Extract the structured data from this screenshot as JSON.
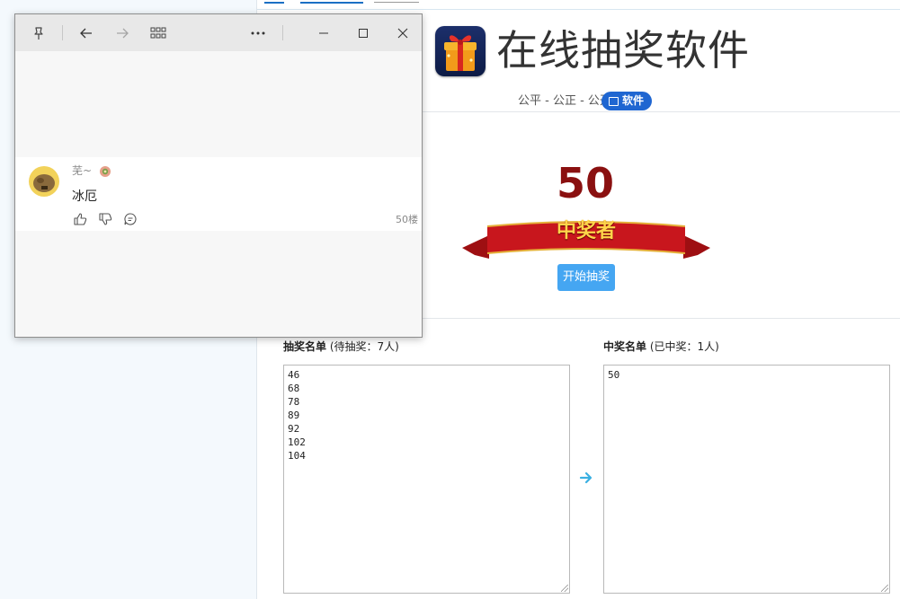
{
  "page": {
    "title": "在线抽奖软件",
    "subtitle": "公平 - 公正 - 公开",
    "badge": "软件",
    "winner_display": "50",
    "ribbon_label": "中奖者",
    "start_button": "开始抽奖",
    "pool_list": {
      "title": "抽奖名单",
      "count_text": "(待抽奖：7人)",
      "entries": [
        "46",
        "68",
        "78",
        "89",
        "92",
        "102",
        "104"
      ]
    },
    "winner_list": {
      "title": "中奖名单",
      "count_text": "(已中奖：1人)",
      "entries": [
        "50"
      ]
    },
    "colors": {
      "accent": "#1f66d1",
      "button": "#45a6f2",
      "winner_number": "#8a1010",
      "ribbon": "#c8161d"
    }
  },
  "popup": {
    "titlebar_icons": [
      "pin-icon",
      "back-arrow-icon",
      "forward-arrow-icon",
      "grid-icon",
      "more-icon",
      "minimize-icon",
      "maximize-icon",
      "close-icon"
    ],
    "post": {
      "username": "芜~",
      "text": "冰厄",
      "floor": "50楼",
      "actions": [
        "thumbs-up-icon",
        "thumbs-down-icon",
        "comment-icon"
      ]
    }
  }
}
